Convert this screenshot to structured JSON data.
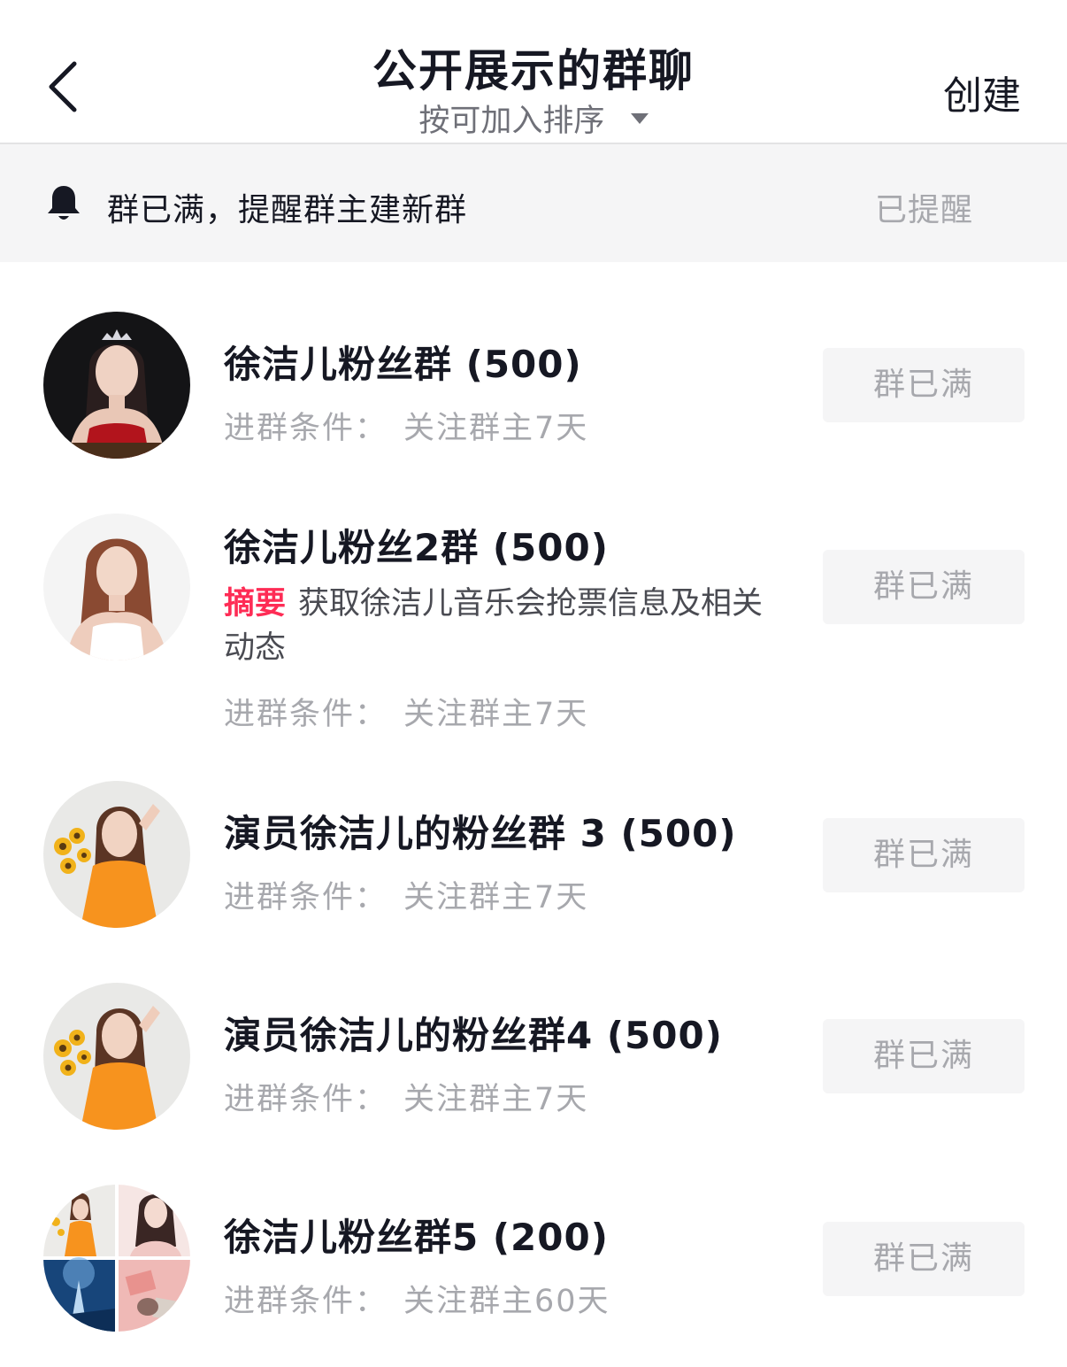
{
  "header": {
    "title": "公开展示的群聊",
    "sort_label": "按可加入排序",
    "create_label": "创建"
  },
  "notice": {
    "text": "群已满，提醒群主建新群",
    "status": "已提醒"
  },
  "groups": [
    {
      "name": "徐洁儿粉丝群 (500)",
      "condition_label": "进群条件：",
      "condition_value": "关注群主7天",
      "button_label": "群已满"
    },
    {
      "name": "徐洁儿粉丝2群 (500)",
      "summary_tag": "摘要",
      "summary_text": "获取徐洁儿音乐会抢票信息及相关动态",
      "condition_label": "进群条件：",
      "condition_value": "关注群主7天",
      "button_label": "群已满"
    },
    {
      "name": "演员徐洁儿的粉丝群 3 (500)",
      "condition_label": "进群条件：",
      "condition_value": "关注群主7天",
      "button_label": "群已满"
    },
    {
      "name": "演员徐洁儿的粉丝群4 (500)",
      "condition_label": "进群条件：",
      "condition_value": "关注群主7天",
      "button_label": "群已满"
    },
    {
      "name": "徐洁儿粉丝群5 (200)",
      "condition_label": "进群条件：",
      "condition_value": "关注群主60天",
      "button_label": "群已满"
    }
  ],
  "colors": {
    "accent_red": "#fe2c55",
    "muted_text": "#a7a8ad",
    "button_bg": "#f5f5f6"
  }
}
